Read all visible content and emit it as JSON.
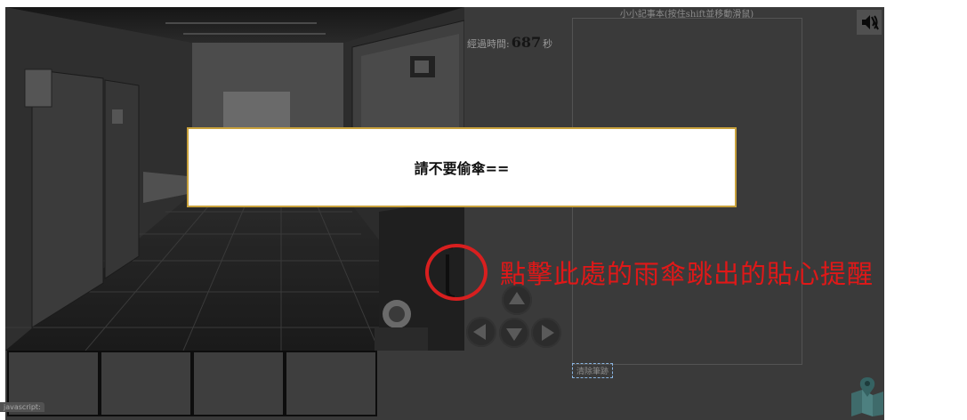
{
  "timer": {
    "label": "經過時間:",
    "value": "687",
    "unit": "秒"
  },
  "notebook": {
    "title": "小小記事本(按住shift並移動滑鼠)"
  },
  "buttons": {
    "clear_notes": "清除筆跡"
  },
  "dialog": {
    "message": "請不要偷傘=="
  },
  "annotation": {
    "text": "點擊此處的雨傘跳出的貼心提醒",
    "color": "#e01818"
  },
  "status_bar": {
    "text": "javascript:"
  },
  "inventory": {
    "slots": [
      "",
      "",
      "",
      ""
    ]
  },
  "icons": {
    "mute": "speaker-muted-icon",
    "map": "map-pin-icon",
    "arrows": [
      "arrow-up-icon",
      "arrow-left-icon",
      "arrow-down-icon",
      "arrow-right-icon"
    ]
  },
  "colors": {
    "overlay": "#3a3a3a",
    "dialog_border": "#c8a13c",
    "annotation": "#d81f1f"
  }
}
